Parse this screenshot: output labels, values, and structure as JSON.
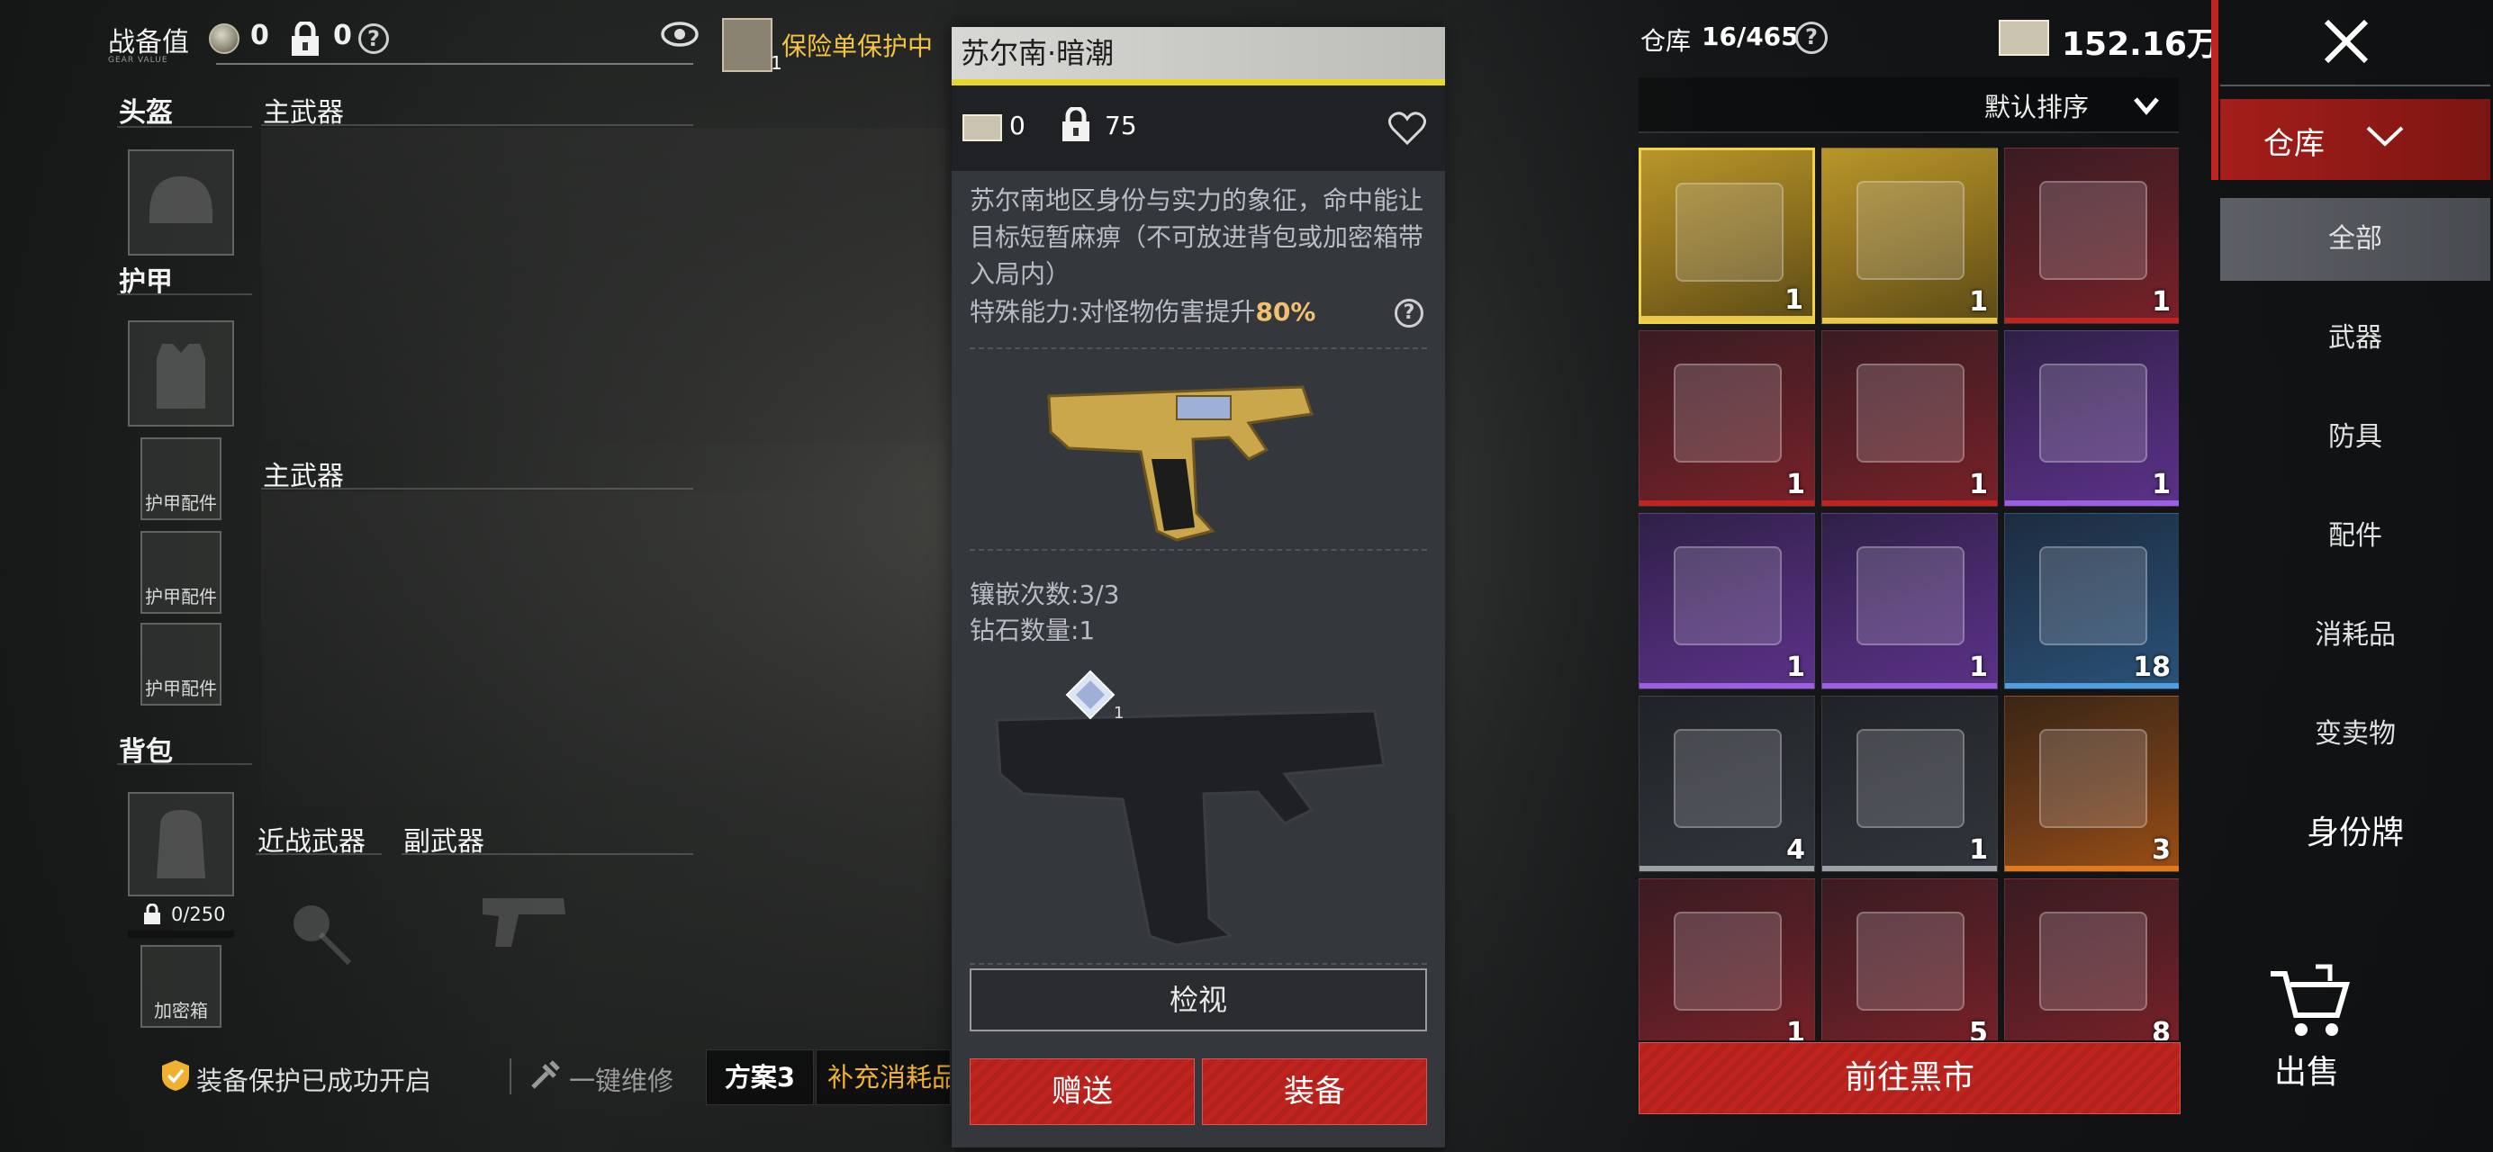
{
  "header": {
    "gear_value_label": "战备值",
    "gear_value_sub": "GEAR VALUE",
    "coin_amount": "0",
    "lock_amount": "0",
    "insurance_count": "1",
    "insurance_label": "保险单保护中"
  },
  "loadout": {
    "helmet_label": "头盔",
    "armor_label": "护甲",
    "armor_attach_1": "护甲配件",
    "armor_attach_2": "护甲配件",
    "armor_attach_3": "护甲配件",
    "backpack_label": "背包",
    "backpack_capacity": "0/250",
    "secure_case_label": "加密箱",
    "primary_weapon_1": "主武器",
    "primary_weapon_2": "主武器",
    "melee_label": "近战武器",
    "secondary_label": "副武器"
  },
  "bottom_bar": {
    "protection_status": "装备保护已成功开启",
    "repair_label": "一键维修",
    "plan_label": "方案3",
    "refill_label": "补充消耗品"
  },
  "item_detail": {
    "title": "苏尔南·暗潮",
    "coin_value": "0",
    "lock_value": "75",
    "description": "苏尔南地区身份与实力的象征，命中能让目标短暂麻痹（不可放进背包或加密箱带入局内）",
    "special_prefix": "特殊能力:对怪物伤害提升",
    "special_value": "80%",
    "inlay_count": "镶嵌次数:3/3",
    "diamond_count": "钻石数量:1",
    "diamond_slot_num": "1",
    "inspect_button": "检视",
    "gift_button": "赠送",
    "equip_button": "装备"
  },
  "warehouse": {
    "label": "仓库",
    "capacity": "16/465",
    "currency": "152.16万",
    "sort_label": "默认排序",
    "tab_label": "仓库",
    "categories": [
      "全部",
      "武器",
      "防具",
      "配件",
      "消耗品",
      "变卖物",
      "身份牌"
    ],
    "selected_category": "全部",
    "sell_label": "出售",
    "market_button": "前往黑市",
    "items": [
      {
        "count": "1",
        "rarity": "gold",
        "icon": "pistol-icon"
      },
      {
        "count": "1",
        "rarity": "gold",
        "icon": "armor-suit-icon"
      },
      {
        "count": "1",
        "rarity": "red",
        "icon": "black-case-icon"
      },
      {
        "count": "1",
        "rarity": "red",
        "icon": "orange-case-icon"
      },
      {
        "count": "1",
        "rarity": "red",
        "icon": "blue-card-icon"
      },
      {
        "count": "1",
        "rarity": "purple",
        "icon": "silver-case-icon"
      },
      {
        "count": "1",
        "rarity": "purple",
        "icon": "steel-case-icon"
      },
      {
        "count": "1",
        "rarity": "purple",
        "icon": "purple-case-icon"
      },
      {
        "count": "18",
        "rarity": "blue",
        "icon": "cooler-box-icon"
      },
      {
        "count": "4",
        "rarity": "gray",
        "icon": "ammo-box-icon"
      },
      {
        "count": "1",
        "rarity": "gray",
        "icon": "red-pouch-icon"
      },
      {
        "count": "3",
        "rarity": "orange",
        "icon": "gold-anchor-icon"
      },
      {
        "count": "1",
        "rarity": "red",
        "icon": "documents-icon"
      },
      {
        "count": "5",
        "rarity": "red",
        "icon": "gold-bar-icon"
      },
      {
        "count": "8",
        "rarity": "red",
        "icon": "diamonds-icon"
      }
    ]
  },
  "colors": {
    "accent_red": "#c0241f",
    "accent_yellow": "#e9d82c",
    "highlight_orange": "#f0c070"
  }
}
